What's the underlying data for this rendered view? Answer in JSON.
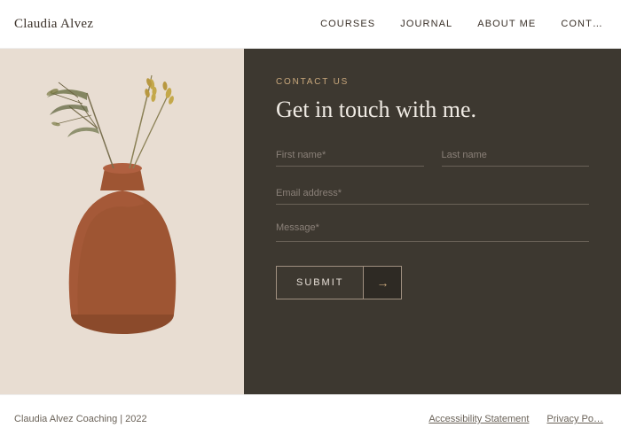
{
  "header": {
    "logo": "Claudia Alvez",
    "nav": [
      {
        "label": "Courses",
        "id": "courses"
      },
      {
        "label": "Journal",
        "id": "journal"
      },
      {
        "label": "About Me",
        "id": "about-me"
      },
      {
        "label": "Cont…",
        "id": "contact"
      }
    ]
  },
  "contact": {
    "section_label": "Contact Us",
    "heading": "Get in touch with me.",
    "fields": {
      "first_name": "First name*",
      "last_name": "Last name",
      "email": "Email address*",
      "message": "Message*"
    },
    "submit_label": "Submit",
    "arrow": "→"
  },
  "footer": {
    "copyright": "Claudia Alvez Coaching  |  2022",
    "links": [
      {
        "label": "Accessibility Statement",
        "id": "accessibility"
      },
      {
        "label": "Privacy Po…",
        "id": "privacy"
      }
    ]
  }
}
